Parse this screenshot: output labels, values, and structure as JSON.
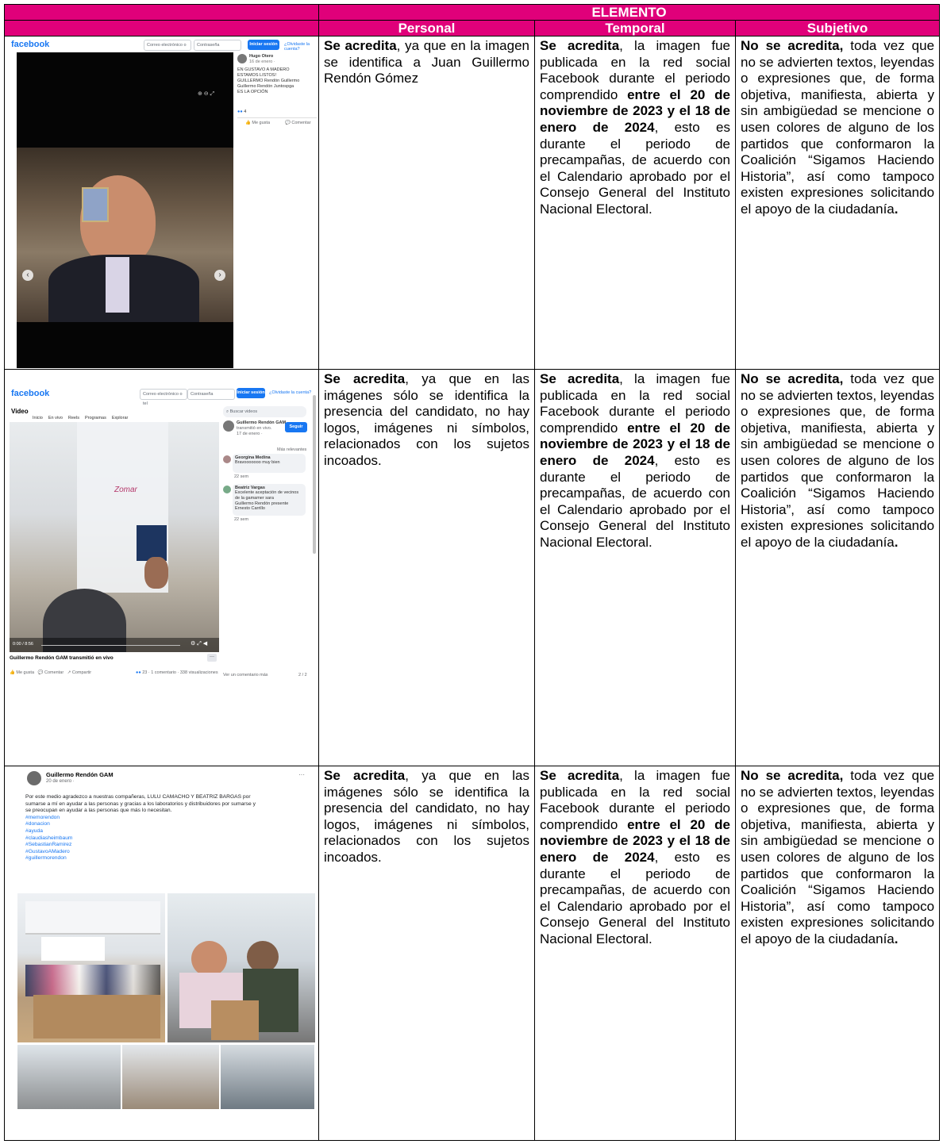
{
  "table": {
    "header_main": "ELEMENTO",
    "col_personal": "Personal",
    "col_temporal": "Temporal",
    "col_subjetivo": "Subjetivo"
  },
  "colors": {
    "header_bg": "#E0007A",
    "header_text": "#FFFFFF",
    "facebook_blue": "#1877F2"
  },
  "text": {
    "personal1_bold": "Se acredita",
    "personal1_rest": ", ya que en la imagen se identifica a Juan Guillermo Rendón Gómez",
    "personal23_bold": "Se acredita",
    "personal23_rest": ", ya que en las imágenes sólo se identifica la presencia del candidato, no hay logos, imágenes ni símbolos, relacionados con los sujetos incoados.",
    "temporal_bold1": "Se acredita",
    "temporal_mid": ", la imagen fue publicada en la red social Facebook durante el periodo comprendido ",
    "temporal_bold2": "entre el 20 de noviembre de 2023 y el 18 de enero de 2024",
    "temporal_end": ", esto es durante el periodo de precampañas, de acuerdo con el Calendario aprobado por el Consejo General del Instituto Nacional Electoral.",
    "subjetivo_bold": "No se acredita,",
    "subjetivo_rest": " toda vez que no se advierten textos, leyendas o expresiones que, de forma objetiva, manifiesta, abierta y sin ambigüedad se mencione o usen colores de alguno de los partidos que conformaron la Coalición “Sigamos Haciendo Historia”, así como tampoco existen expresiones solicitando el apoyo de la ciudadanía",
    "subjetivo_end": "."
  },
  "shot1": {
    "logo": "facebook",
    "email_placeholder": "Correo electrónico o tel",
    "password_placeholder": "Contraseña",
    "login_button": "Iniciar sesión",
    "forgot_link": "¿Olvidaste la cuenta?",
    "author": "Hugo Otero",
    "date": "16 de enero · ",
    "caption": [
      "EN GUSTAVO A MADERO",
      "ESTAMOS LISTOS!",
      "GUILLERMO Rendón Guillermo",
      "Guillermo Rendón Juntospga",
      "ES LA OPCIÓN"
    ],
    "reactions_count": "4",
    "like_label": "Me gusta",
    "comment_label": "Comentar"
  },
  "shot2": {
    "logo": "facebook",
    "email_placeholder": "Correo electrónico o tel",
    "password_placeholder": "Contraseña",
    "login_button": "Iniciar sesión",
    "forgot_link": "¿Olvidaste la cuenta?",
    "video_label": "Video",
    "tabs": [
      "Inicio",
      "En vivo",
      "Reels",
      "Programas",
      "Explorar"
    ],
    "search_placeholder": "Buscar videos",
    "page_name": "Guillermo Rendón GAM",
    "transmitted": "transmitió en vivo.",
    "date": "17 de enero · ",
    "follow_button": "Seguir",
    "most_relevant": "Más relevantes",
    "comment1_author": "Georgina Medina",
    "comment1_text": "Bravooooooo muy bien",
    "comment1_time": "22 sem",
    "comment2_author": "Beatriz Vargas",
    "comment2_text": "Excelente aceptación de vecinos de la gamamer sara",
    "comment2_line2": "Guillermo Rendón presente",
    "comment2_line3": "Ernesto Carrillo",
    "comment2_time": "22 sem",
    "video_time": "0:00 / 8:56",
    "video_title": "Guillermo Rendón GAM transmitió en vivo",
    "like_label": "Me gusta",
    "comment_label": "Comentar",
    "share_label": "Compartir",
    "stats": "23 · 1 comentario · 338 visualizaciones",
    "see_more": "Ver un comentario más",
    "count_2": "2 / 2"
  },
  "shot3": {
    "page_name": "Guillermo Rendón GAM",
    "date": "20 de enero · ",
    "body_line1": "Por este medio agradezco a nuestras compañeras,  LULU CAMACHO Y BEATRIZ BARGAS por",
    "body_line2": "sumarse a mí en ayudar a las personas y gracias a los laboratorios y distribuidores por sumarse y",
    "body_line3": "se preocupan en ayudar a las personas que más lo necesitan.",
    "hashtags": [
      "#memorendon",
      "#donacion",
      "#ayuda",
      "#claudiasheimbaum",
      "#SebastianRamirez",
      "#GustavoAMadero",
      "#guillermorendon"
    ],
    "more": "···"
  }
}
